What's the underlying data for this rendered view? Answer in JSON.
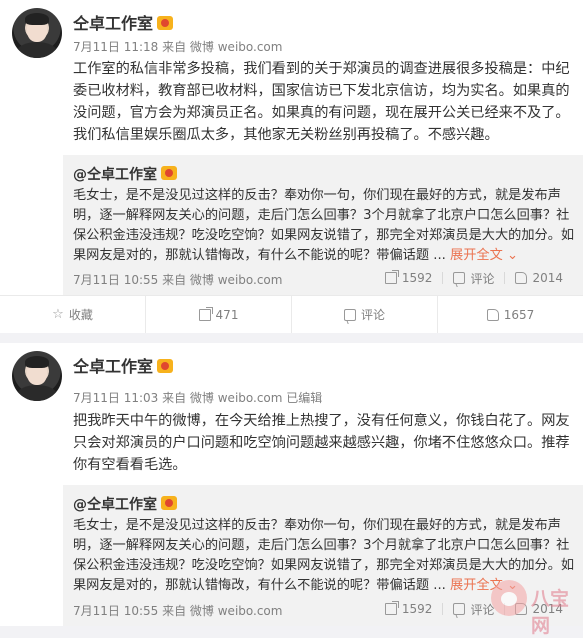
{
  "posts": [
    {
      "author": "仝卓工作室",
      "meta": "7月11日 11:18 来自 微博 weibo.com",
      "text": "工作室的私信非常多投稿，我们看到的关于郑演员的调查进展很多投稿是：中纪委已收材料，教育部已收材料，国家信访已下发北京信访，均为实名。如果真的没问题，官方会为郑演员正名。如果真的有问题，现在展开公关已经来不及了。我们私信里娱乐圈瓜太多，其他家无关粉丝别再投稿了。不感兴趣。",
      "repost": {
        "author": "@仝卓工作室",
        "text": "毛女士，是不是没见过这样的反击？奉劝你一句，你们现在最好的方式，就是发布声明，逐一解释网友关心的问题，走后门怎么回事？3个月就拿了北京户口怎么回事？社保公积金违没违规？吃没吃空饷？如果网友说错了，那完全对郑演员是大大的加分。如果网友是对的，那就认错悔改，有什么不能说的呢？带偏话题 ...",
        "expand": "展开全文",
        "time": "7月11日 10:55 来自 微博 weibo.com",
        "shares": "1592",
        "comments": "评论",
        "likes": "2014"
      },
      "actions": {
        "favorite": "收藏",
        "shares": "471",
        "comment": "评论",
        "likes": "1657"
      }
    },
    {
      "author": "仝卓工作室",
      "meta": "7月11日 11:03 来自 微博 weibo.com  已编辑",
      "text": "把我昨天中午的微博，在今天给推上热搜了，没有任何意义，你钱白花了。网友只会对郑演员的户口问题和吃空饷问题越来越感兴趣，你堵不住悠悠众口。推荐你有空看看毛选。",
      "repost": {
        "author": "@仝卓工作室",
        "text": "毛女士，是不是没见过这样的反击？奉劝你一句，你们现在最好的方式，就是发布声明，逐一解释网友关心的问题，走后门怎么回事？3个月就拿了北京户口怎么回事？社保公积金违没违规？吃没吃空饷？如果网友说错了，那完全对郑演员是大大的加分。如果网友是对的，那就认错悔改，有什么不能说的呢？带偏话题 ...",
        "expand": "展开全文",
        "time": "7月11日 10:55 来自 微博 weibo.com",
        "shares": "1592",
        "comments": "评论",
        "likes": "2014"
      }
    }
  ],
  "watermark": "八宝网"
}
